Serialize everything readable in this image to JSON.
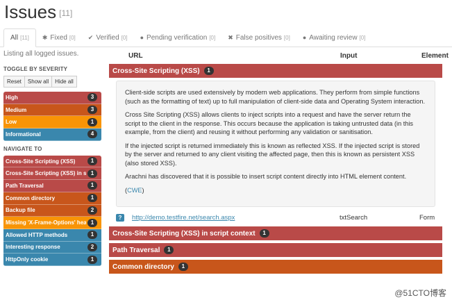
{
  "header": {
    "title": "Issues",
    "count": "[11]"
  },
  "tabs": [
    {
      "label": "All",
      "count": "[11]",
      "icon": ""
    },
    {
      "label": "Fixed",
      "count": "[0]",
      "icon": "✱"
    },
    {
      "label": "Verified",
      "count": "[0]",
      "icon": "✔"
    },
    {
      "label": "Pending verification",
      "count": "[0]",
      "icon": "●"
    },
    {
      "label": "False positives",
      "count": "[0]",
      "icon": "✖"
    },
    {
      "label": "Awaiting review",
      "count": "[0]",
      "icon": "●"
    }
  ],
  "sidebar": {
    "listing": "Listing all logged issues.",
    "toggle_heading": "TOGGLE BY SEVERITY",
    "buttons": [
      "Reset",
      "Show all",
      "Hide all"
    ],
    "severities": [
      {
        "label": "High",
        "count": "3"
      },
      {
        "label": "Medium",
        "count": "3"
      },
      {
        "label": "Low",
        "count": "1"
      },
      {
        "label": "Informational",
        "count": "4"
      }
    ],
    "nav_heading": "NAVIGATE TO",
    "nav": [
      {
        "label": "Cross-Site Scripting (XSS)",
        "count": "1"
      },
      {
        "label": "Cross-Site Scripting (XSS) in script context",
        "count": "1"
      },
      {
        "label": "Path Traversal",
        "count": "1"
      },
      {
        "label": "Common directory",
        "count": "1"
      },
      {
        "label": "Backup file",
        "count": "2"
      },
      {
        "label": "Missing 'X-Frame-Options' header",
        "count": "1"
      },
      {
        "label": "Allowed HTTP methods",
        "count": "1"
      },
      {
        "label": "Interesting response",
        "count": "2"
      },
      {
        "label": "HttpOnly cookie",
        "count": "1"
      }
    ]
  },
  "columns": {
    "url": "URL",
    "input": "Input",
    "element": "Element"
  },
  "groups": {
    "xss": {
      "title": "Cross-Site Scripting (XSS)",
      "count": "1"
    },
    "xss_script": {
      "title": "Cross-Site Scripting (XSS) in script context",
      "count": "1"
    },
    "path": {
      "title": "Path Traversal",
      "count": "1"
    },
    "common": {
      "title": "Common directory",
      "count": "1"
    }
  },
  "description": {
    "p1": "Client-side scripts are used extensively by modern web applications. They perform from simple functions (such as the formatting of text) up to full manipulation of client-side data and Operating System interaction.",
    "p2": "Cross Site Scripting (XSS) allows clients to inject scripts into a request and have the server return the script to the client in the response. This occurs because the application is taking untrusted data (in this example, from the client) and reusing it without performing any validation or sanitisation.",
    "p3": "If the injected script is returned immediately this is known as reflected XSS. If the injected script is stored by the server and returned to any client visiting the affected page, then this is known as persistent XSS (also stored XSS).",
    "p4": "Arachni has discovered that it is possible to insert script content directly into HTML element content.",
    "ref_open": "(",
    "ref_link": "CWE",
    "ref_close": ")"
  },
  "issue": {
    "icon_text": "?",
    "url": "http://demo.testfire.net/search.aspx",
    "input": "txtSearch",
    "element": "Form"
  },
  "watermark": "@51CTO博客",
  "colors": {
    "high": "#b94a48",
    "medium": "#c8561b",
    "low": "#f89406",
    "info": "#3a87ad"
  }
}
